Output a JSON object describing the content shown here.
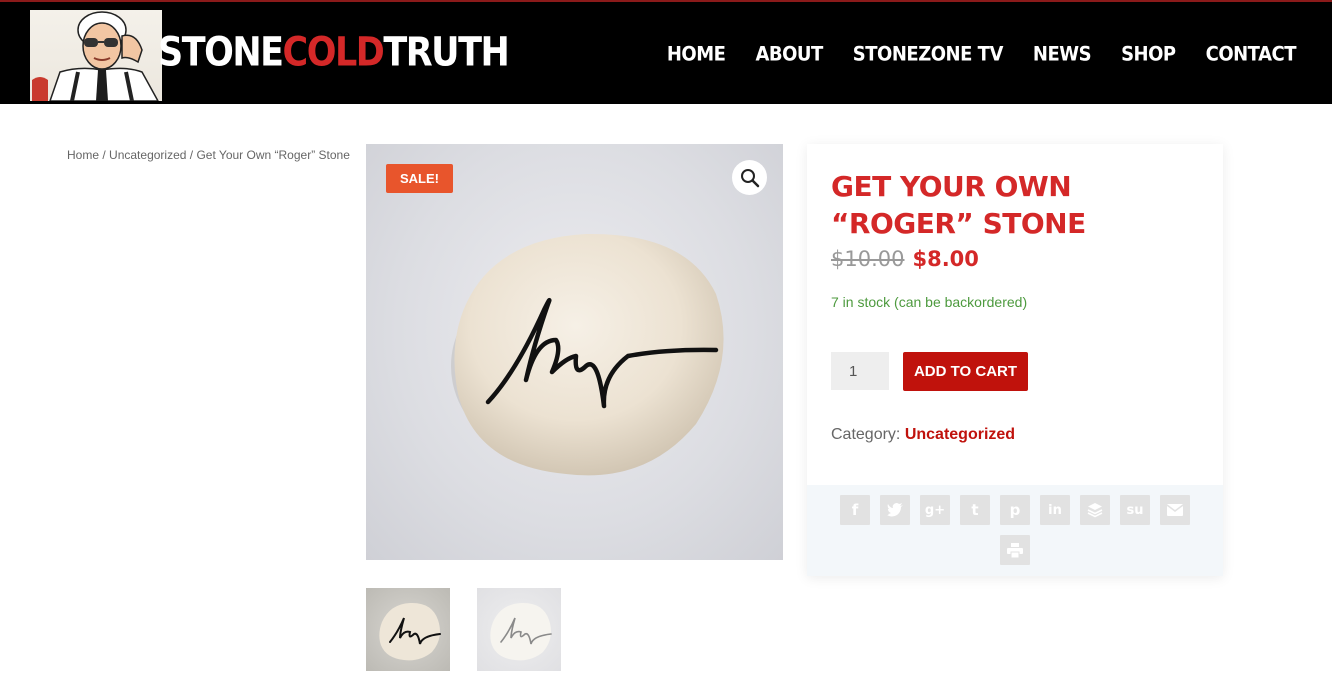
{
  "header": {
    "logo": {
      "part1": "STONE",
      "part2": "COLD",
      "part3": "TRUTH"
    },
    "nav": [
      "HOME",
      "ABOUT",
      "STONEZONE TV",
      "NEWS",
      "SHOP",
      "CONTACT"
    ]
  },
  "breadcrumb": {
    "home": "Home",
    "sep": "/",
    "category": "Uncategorized",
    "current": "Get Your Own “Roger” Stone"
  },
  "product": {
    "sale_badge": "SALE!",
    "title": "GET YOUR OWN “ROGER” STONE",
    "old_price": "$10.00",
    "new_price": "$8.00",
    "stock": "7 in stock (can be backordered)",
    "quantity": "1",
    "add_to_cart": "ADD TO CART",
    "category_label": "Category:",
    "category_value": "Uncategorized"
  },
  "share_icons": [
    "facebook-icon",
    "twitter-icon",
    "google-plus-icon",
    "tumblr-icon",
    "pinterest-icon",
    "linkedin-icon",
    "buffer-icon",
    "stumbleupon-icon",
    "email-icon",
    "print-icon"
  ],
  "colors": {
    "brand_red": "#d42828",
    "button_red": "#c0120c",
    "sale_orange": "#e8552c",
    "stock_green": "#4d9a3e",
    "header_bg": "#000000"
  }
}
